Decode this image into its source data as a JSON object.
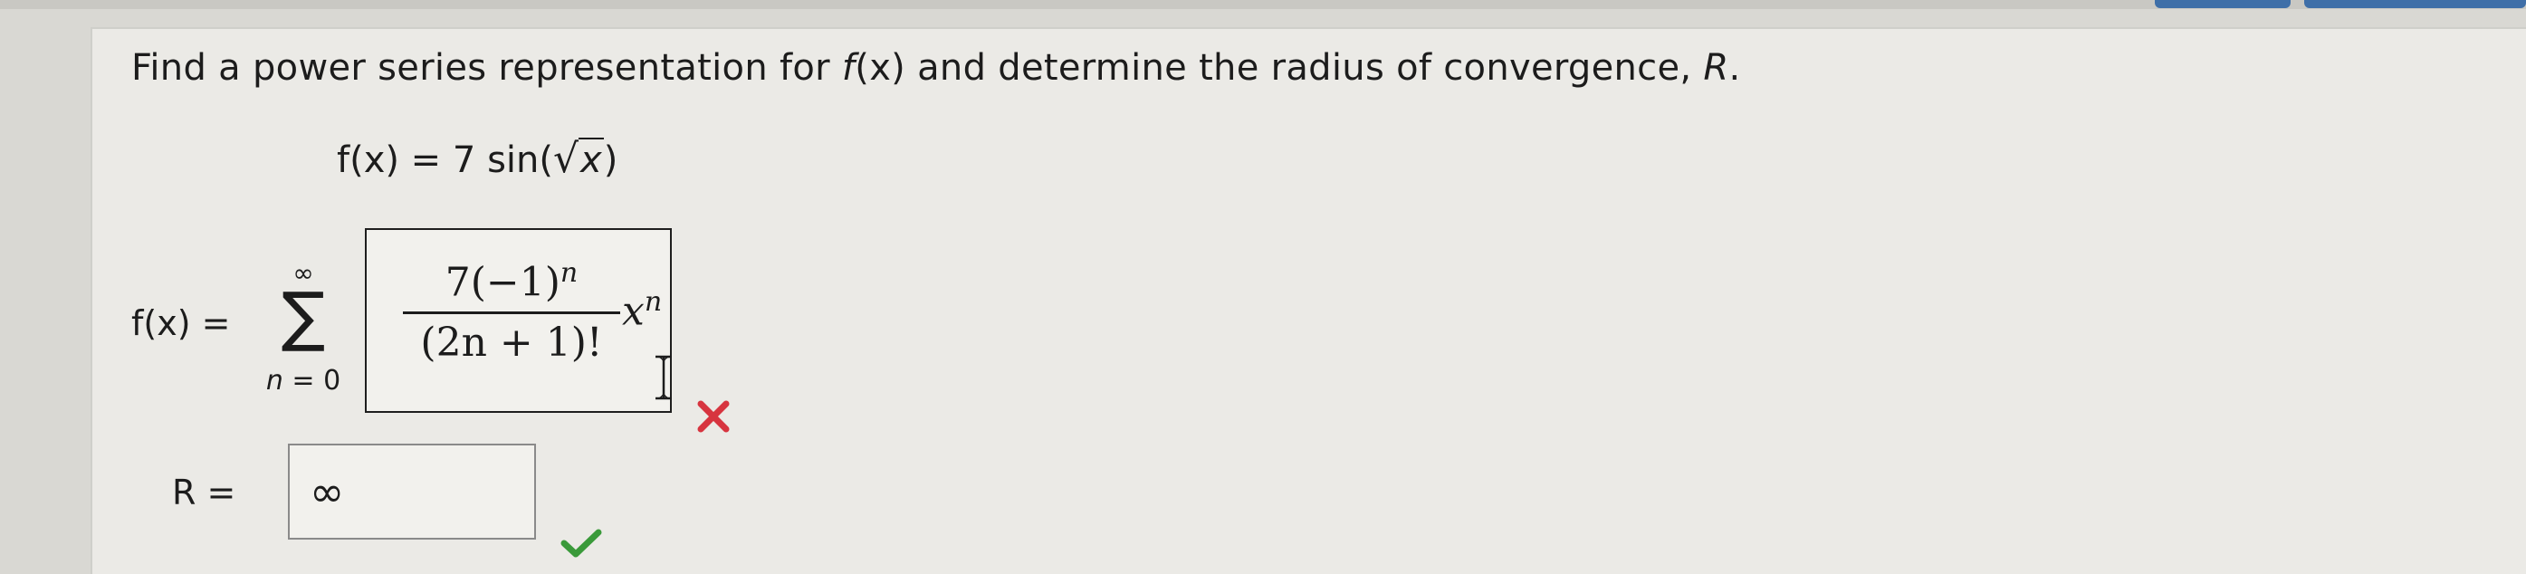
{
  "question": {
    "text_before": "Find a power series representation for ",
    "fx": "f",
    "fx_arg": "(x)",
    "text_after": " and determine the radius of convergence, ",
    "R": "R",
    "period": "."
  },
  "given": {
    "lhs": "f(x) = 7 sin(",
    "radicand": "x",
    "rhs": ")"
  },
  "series": {
    "lhs": "f(x) =",
    "sum_upper": "∞",
    "sum_symbol": "∑",
    "sum_lower_var": "n",
    "sum_lower_rest": " = 0",
    "answer": {
      "numerator": "7(−1)",
      "numerator_exp": "n",
      "denominator": "(2n + 1)!",
      "x": "x",
      "x_exp": "n"
    },
    "status": "incorrect"
  },
  "radius": {
    "label": "R =",
    "value": "∞",
    "status": "correct"
  },
  "colors": {
    "incorrect": "#d7343f",
    "correct": "#3a9a3a",
    "panel": "#ebeae6"
  }
}
